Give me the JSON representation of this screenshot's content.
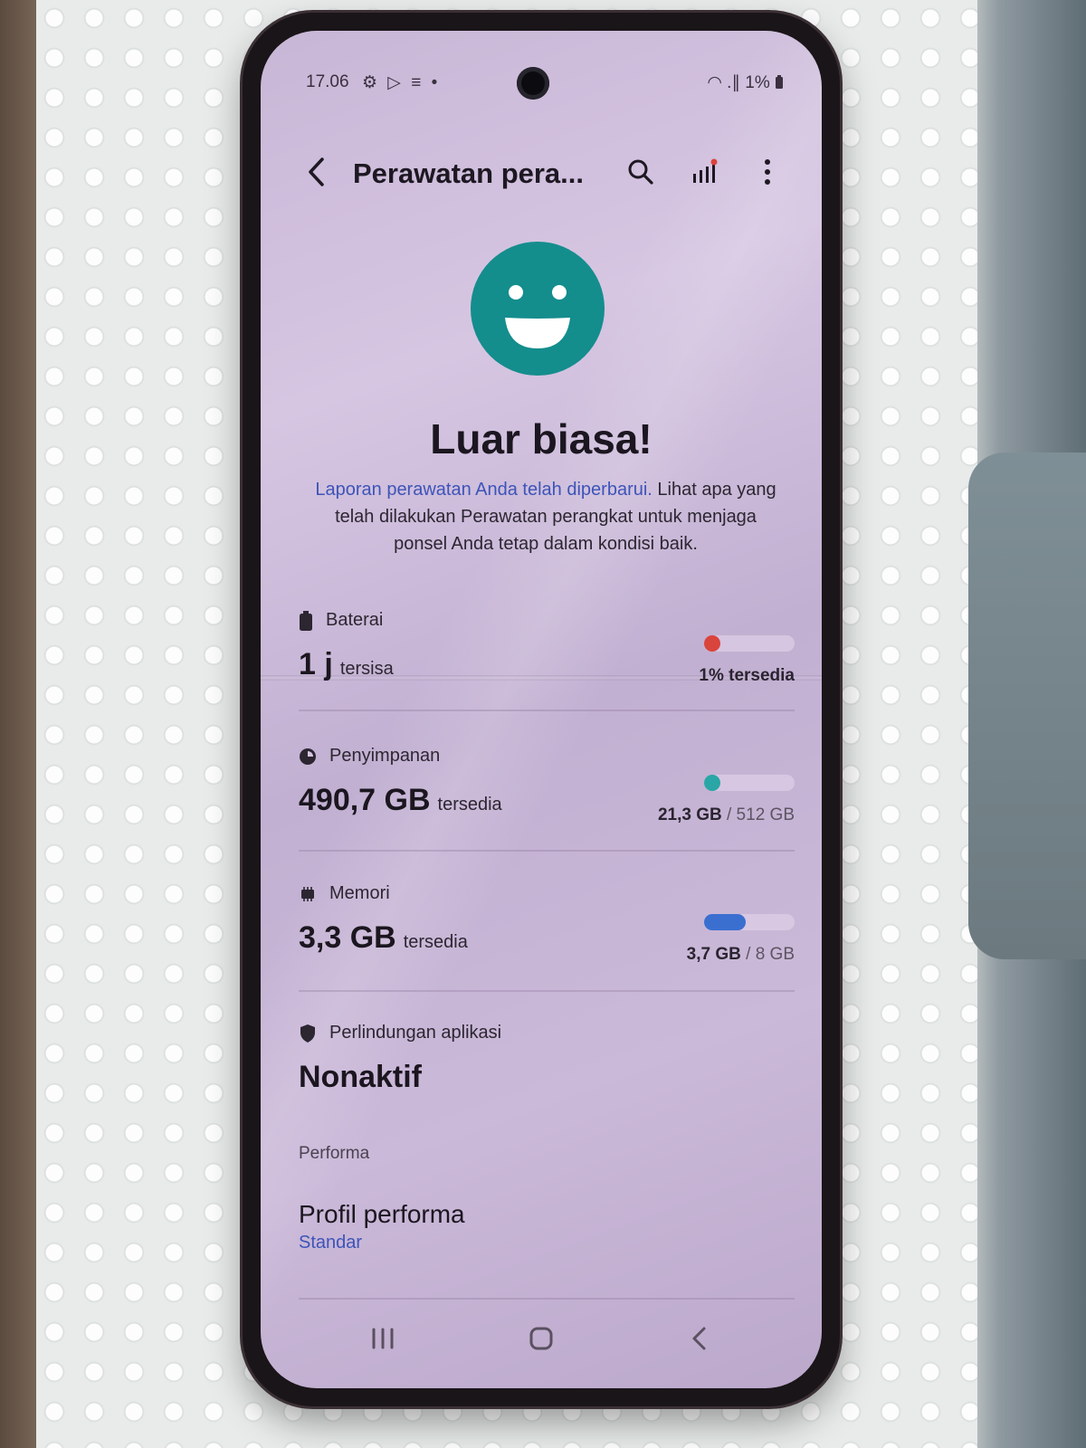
{
  "status_bar": {
    "time": "17.06",
    "left_icons": "⚙ ▷ ≡ •",
    "right_icons": "◠ .∥",
    "battery": "1%"
  },
  "app_bar": {
    "title": "Perawatan pera...",
    "icons": [
      "back-icon",
      "search-icon",
      "stats-icon",
      "more-icon"
    ]
  },
  "hero": {
    "headline": "Luar biasa!",
    "link_text": "Laporan perawatan Anda telah diperbarui.",
    "body_text": " Lihat apa yang telah dilakukan Perawatan perangkat untuk menjaga ponsel Anda tetap dalam kondisi baik."
  },
  "battery": {
    "label": "Baterai",
    "value": "1 j",
    "unit": "tersisa",
    "caption": "1% tersedia",
    "level_percent": 1,
    "color": "#d9443d"
  },
  "storage": {
    "label": "Penyimpanan",
    "value": "490,7 GB",
    "unit": "tersedia",
    "used": "21,3 GB",
    "total": "/ 512 GB",
    "used_fraction": 0.042,
    "color": "#2aa6a6"
  },
  "memory": {
    "label": "Memori",
    "value": "3,3 GB",
    "unit": "tersedia",
    "used": "3,7 GB",
    "total": "/ 8 GB",
    "used_fraction": 0.46,
    "color": "#3a6fd0"
  },
  "app_protection": {
    "label": "Perlindungan aplikasi",
    "value": "Nonaktif"
  },
  "performance": {
    "section_label": "Performa",
    "title": "Profil performa",
    "subtitle": "Standar"
  },
  "navigation": {
    "icons": [
      "recents-icon",
      "home-icon",
      "back-nav-icon"
    ]
  },
  "colors": {
    "accent_teal": "#148d8d",
    "link_blue": "#3d54b8"
  }
}
